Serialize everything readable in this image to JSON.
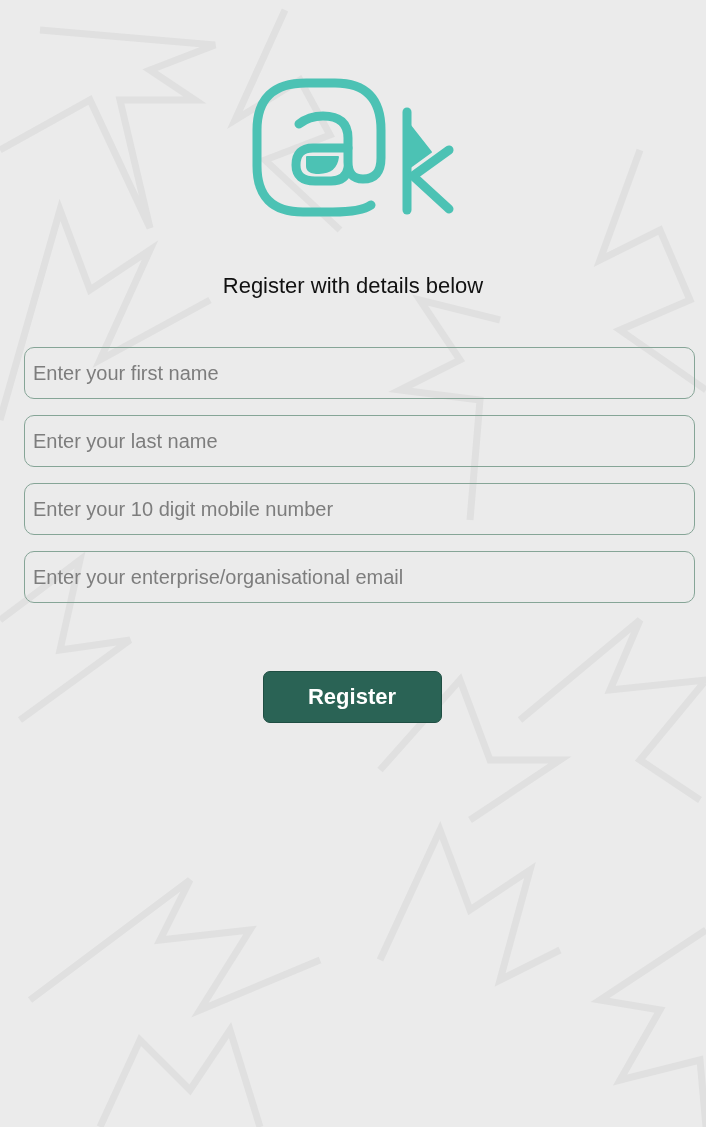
{
  "heading": "Register with details below",
  "fields": [
    {
      "placeholder": "Enter your first name"
    },
    {
      "placeholder": "Enter your last name"
    },
    {
      "placeholder": "Enter your 10 digit mobile number"
    },
    {
      "placeholder": "Enter your enterprise/organisational email"
    }
  ],
  "button": {
    "label": "Register"
  }
}
